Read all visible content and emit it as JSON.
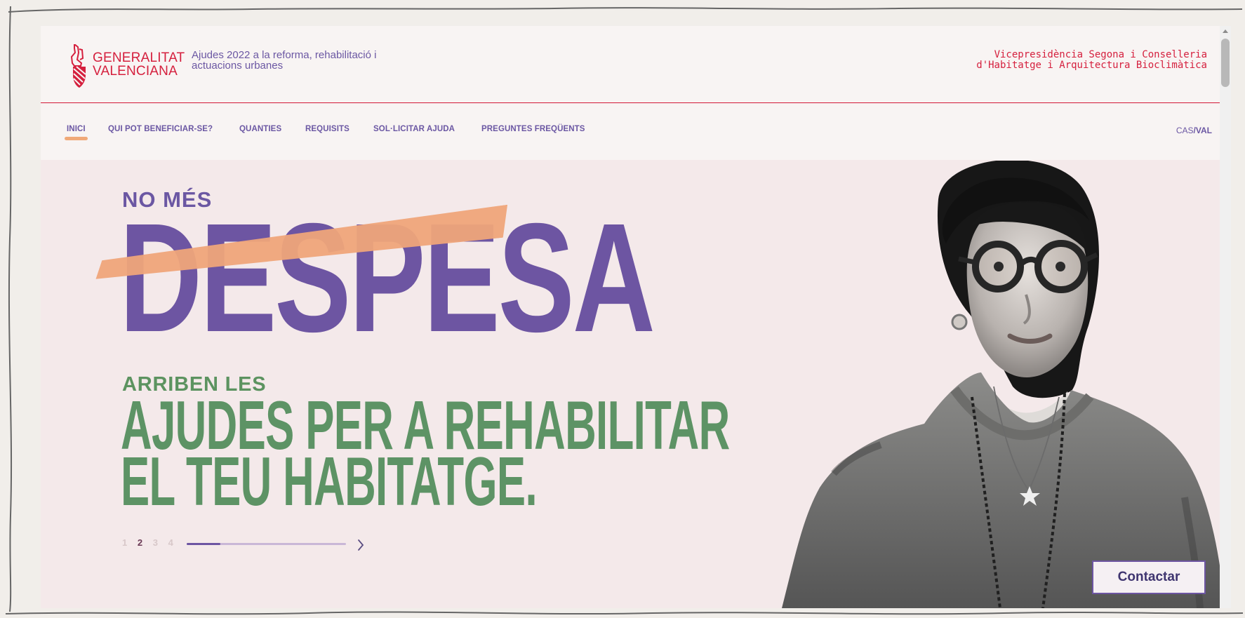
{
  "header": {
    "logo_line1": "GENERALITAT",
    "logo_line2": "VALENCIANA",
    "tagline": "Ajudes 2022 a la reforma, rehabilitació i actuacions urbanes",
    "department_line1": "Vicepresidència Segona i Conselleria",
    "department_line2": "d'Habitatge i Arquitectura Bioclimàtica",
    "accent_color": "#d5203e"
  },
  "nav": {
    "items": [
      {
        "label": "INICI",
        "active": true
      },
      {
        "label": "QUI POT BENEFICIAR-SE?",
        "active": false
      },
      {
        "label": "QUANTIES",
        "active": false
      },
      {
        "label": "REQUISITS",
        "active": false
      },
      {
        "label": "SOL·LICITAR AJUDA",
        "active": false
      },
      {
        "label": "PREGUNTES FREQÜENTS",
        "active": false
      }
    ],
    "language_cas": "CAS",
    "language_separator": "/",
    "language_val": "VAL"
  },
  "hero": {
    "eyebrow": "NO MÉS",
    "struck_word": "DESPESA",
    "intro": "ARRIBEN LES",
    "headline_line1": "AJUDES PER A REHABILITAR",
    "headline_line2": "EL TEU HABITATGE.",
    "slides": [
      "1",
      "2",
      "3",
      "4"
    ],
    "current_slide": "2",
    "progress_fraction": 0.21,
    "purple_color": "#6d55a2",
    "green_color": "#5d9365",
    "peach_color": "#efa57a"
  },
  "actions": {
    "contact_label": "Contactar"
  },
  "icons": {
    "logo": "generalitat-coat-of-arms-icon",
    "next": "chevron-right-icon",
    "scroll_up": "scroll-up-arrow-icon"
  }
}
